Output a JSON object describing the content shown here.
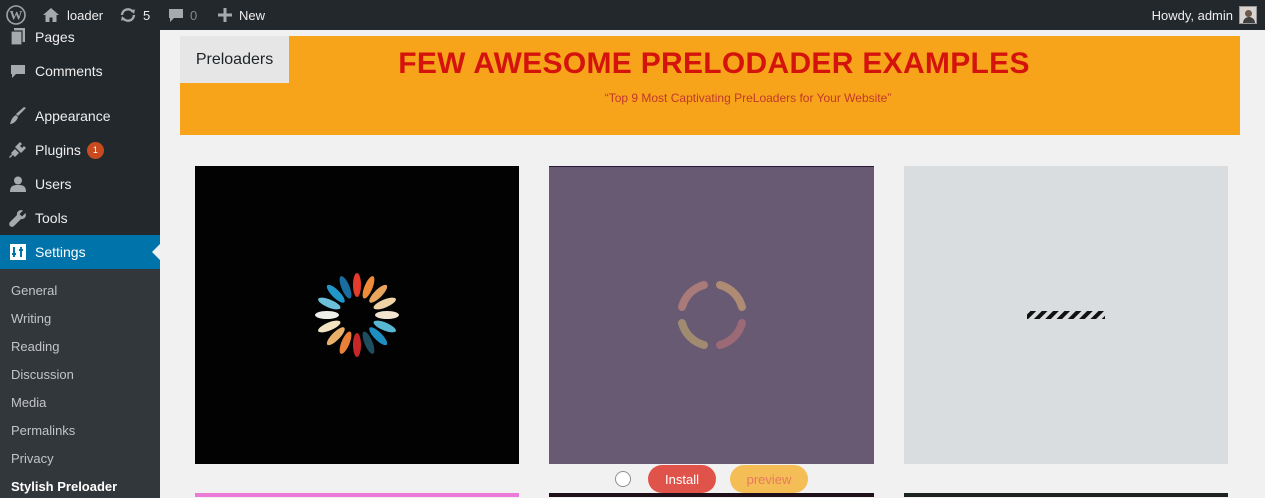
{
  "adminbar": {
    "site_name": "loader",
    "updates_count": "5",
    "comments_count": "0",
    "new_label": "New",
    "howdy": "Howdy, admin"
  },
  "sidebar": {
    "items": [
      {
        "label": "Pages",
        "icon": "pages-icon"
      },
      {
        "label": "Comments",
        "icon": "comments-icon"
      },
      {
        "label": "Appearance",
        "icon": "appearance-icon"
      },
      {
        "label": "Plugins",
        "icon": "plugins-icon",
        "badge": "1"
      },
      {
        "label": "Users",
        "icon": "users-icon"
      },
      {
        "label": "Tools",
        "icon": "tools-icon"
      },
      {
        "label": "Settings",
        "icon": "settings-icon",
        "current": true
      }
    ],
    "submenu": [
      "General",
      "Writing",
      "Reading",
      "Discussion",
      "Media",
      "Permalinks",
      "Privacy",
      "Stylish Preloader"
    ],
    "current_submenu": "Stylish Preloader"
  },
  "main": {
    "tab_label": "Preloaders",
    "banner_title": "FEW AWESOME PRELODADER EXAMPLES",
    "banner_subtitle": "“Top 9 Most Captivating PreLoaders for Your Website”",
    "cards": [
      {
        "background": "#020202"
      },
      {
        "background": "#695a73"
      },
      {
        "background": "#dadddf"
      }
    ],
    "install_label": "Install",
    "preview_label": "preview"
  },
  "colors": {
    "accent": "#0073aa",
    "banner": "#f7a41b",
    "banner_title": "#d4130d",
    "install": "#e0534a",
    "preview": "#f5bd56"
  }
}
